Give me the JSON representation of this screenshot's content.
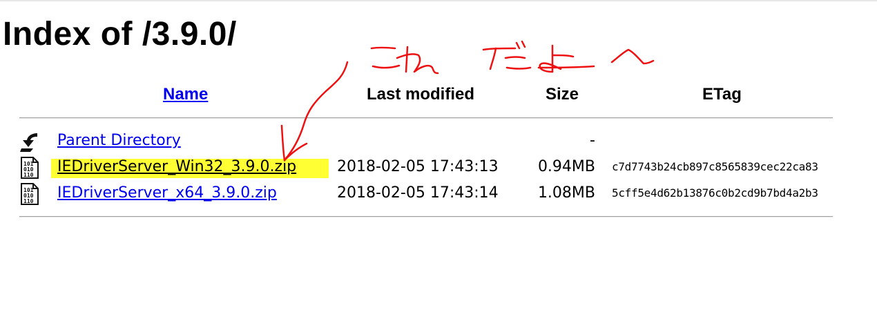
{
  "page": {
    "title": "Index of /3.9.0/"
  },
  "table": {
    "headers": {
      "name": "Name",
      "last_modified": "Last modified",
      "size": "Size",
      "etag": "ETag"
    },
    "rows": [
      {
        "icon": "back-arrow-icon",
        "name": "Parent Directory",
        "last_modified": "",
        "size": "-",
        "etag": ""
      },
      {
        "icon": "binary-file-icon",
        "name": "IEDriverServer_Win32_3.9.0.zip",
        "last_modified": "2018-02-05 17:43:13",
        "size": "0.94MB",
        "etag": "c7d7743b24cb897c8565839cec22ca83",
        "highlighted": true,
        "highlight_color": "#ffff33"
      },
      {
        "icon": "binary-file-icon",
        "name": "IEDriverServer_x64_3.9.0.zip",
        "last_modified": "2018-02-05 17:43:14",
        "size": "1.08MB",
        "etag": "5cff5e4d62b13876c0b2cd9b7bd4a2b3"
      }
    ]
  },
  "annotation": {
    "text": "これだよ〜",
    "color": "#ee1111"
  },
  "colors": {
    "link": "#0000ee",
    "highlight": "#ffff33",
    "annotation": "#ee1111"
  }
}
